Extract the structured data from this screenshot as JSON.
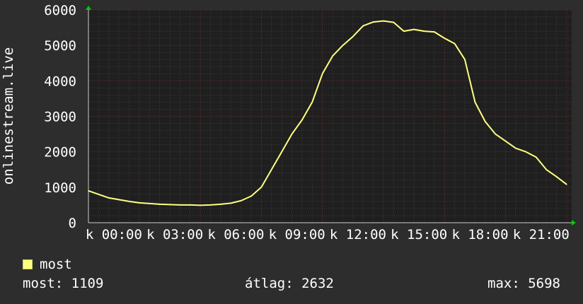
{
  "colors": {
    "background": "#2d2d2d",
    "plot_background": "#1f1f1f",
    "grid_major": "#5a2a2a",
    "grid_minor": "#3d3d3d",
    "axis_arrow": "#00cc00",
    "line": "#ffff80",
    "text": "#ffffff"
  },
  "legend": {
    "label": "most",
    "color": "#ffff80"
  },
  "stats": {
    "current_label": "most:",
    "current_value": "1109",
    "average_label": "átlag:",
    "average_value": "2632",
    "max_label": "max:",
    "max_value": "5698"
  },
  "chart_data": {
    "type": "line",
    "title": "",
    "xlabel": "",
    "ylabel": "onlinestream.live",
    "grid": true,
    "ylim": [
      0,
      6000
    ],
    "yticks": [
      0,
      1000,
      2000,
      3000,
      4000,
      5000,
      6000
    ],
    "xlim_hours": [
      -2.5,
      21.25
    ],
    "xtick_labels": [
      "k 00:00",
      "k 03:00",
      "k 06:00",
      "k 09:00",
      "k 12:00",
      "k 15:00",
      "k 18:00",
      "k 21:00"
    ],
    "xtick_hours": [
      0,
      3,
      6,
      9,
      12,
      15,
      18,
      21
    ],
    "series": [
      {
        "name": "most",
        "color": "#ffff80",
        "x_hours": [
          -2.5,
          -2.0,
          -1.5,
          -1.0,
          -0.5,
          0.0,
          0.5,
          1.0,
          1.5,
          2.0,
          2.5,
          3.0,
          3.5,
          4.0,
          4.5,
          5.0,
          5.5,
          6.0,
          6.5,
          7.0,
          7.5,
          8.0,
          8.5,
          9.0,
          9.5,
          10.0,
          10.5,
          11.0,
          11.5,
          12.0,
          12.5,
          13.0,
          13.5,
          14.0,
          14.5,
          15.0,
          15.5,
          16.0,
          16.5,
          17.0,
          17.5,
          18.0,
          18.5,
          19.0,
          19.5,
          20.0,
          20.5,
          21.0
        ],
        "values": [
          900,
          800,
          700,
          650,
          600,
          560,
          540,
          520,
          510,
          500,
          500,
          490,
          500,
          520,
          550,
          620,
          750,
          1000,
          1500,
          2000,
          2500,
          2900,
          3400,
          4200,
          4700,
          5000,
          5250,
          5550,
          5660,
          5690,
          5650,
          5400,
          5450,
          5400,
          5380,
          5200,
          5050,
          4600,
          3400,
          2850,
          2500,
          2300,
          2100,
          2000,
          1850,
          1500,
          1300,
          1080
        ]
      }
    ]
  }
}
